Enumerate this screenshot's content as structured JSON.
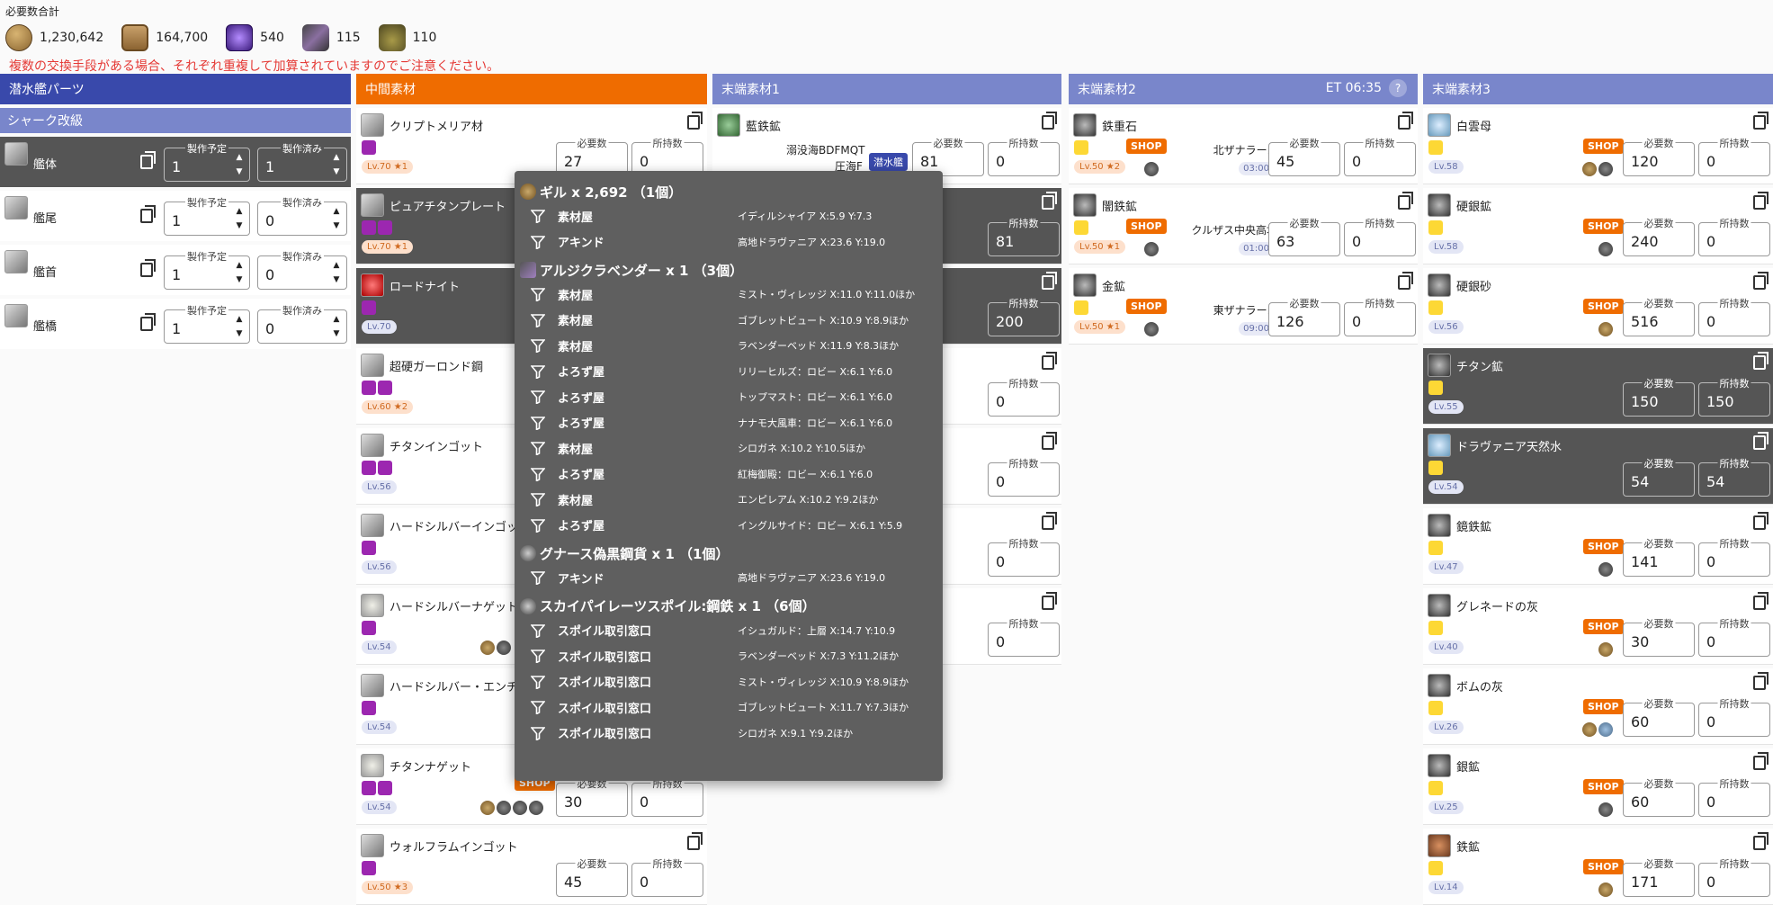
{
  "totals": {
    "label": "必要数合計",
    "items": [
      {
        "icon": "gil-icon",
        "value": "1,230,642"
      },
      {
        "icon": "note-icon",
        "value": "164,700"
      },
      {
        "icon": "purple-token-icon",
        "value": "540"
      },
      {
        "icon": "lavender-icon",
        "value": "115"
      },
      {
        "icon": "acorn-icon",
        "value": "110"
      }
    ],
    "warning": "複数の交換手段がある場合、それぞれ重複して加算されていますのでご注意ください。"
  },
  "headers": {
    "c1": "潜水艦パーツ",
    "c1sub": "シャーク改級",
    "c2": "中間素材",
    "c3": "末端素材1",
    "c4": "末端素材2",
    "c5": "末端素材3",
    "et": "ET 06:35",
    "help": "?"
  },
  "labels": {
    "planned": "製作予定",
    "done": "製作済み",
    "need": "必要数",
    "have": "所持数",
    "shop": "SHOP",
    "sub": "潜水艦"
  },
  "parts": [
    {
      "name": "艦体",
      "planned": "1",
      "done": "1"
    },
    {
      "name": "艦尾",
      "planned": "1",
      "done": "0"
    },
    {
      "name": "艦首",
      "planned": "1",
      "done": "0"
    },
    {
      "name": "艦橋",
      "planned": "1",
      "done": "0"
    }
  ],
  "mid": [
    {
      "name": "クリプトメリア材",
      "lv": "Lv.70 ★1",
      "need": "27",
      "have": "0"
    },
    {
      "name": "ピュアチタンプレート",
      "lv": "Lv.70 ★1"
    },
    {
      "name": "ロードナイト",
      "lv": "Lv.70"
    },
    {
      "name": "超硬ガーロンド鋼",
      "lv": "Lv.60 ★2"
    },
    {
      "name": "チタンインゴット",
      "lv": "Lv.56"
    },
    {
      "name": "ハードシルバーインゴット",
      "lv": "Lv.56"
    },
    {
      "name": "ハードシルバーナゲット",
      "lv": "Lv.54"
    },
    {
      "name": "ハードシルバー・エンチ",
      "lv": "Lv.54"
    },
    {
      "name": "チタンナゲット",
      "lv": "Lv.54",
      "need": "30",
      "have": "0"
    },
    {
      "name": "ウォルフラムインゴット",
      "lv": "Lv.50 ★3",
      "need": "45",
      "have": "0"
    }
  ],
  "t1": [
    {
      "name": "藍鉄鉱",
      "loc": "溺没海BDFMQT",
      "loc2": "圧海F",
      "need": "81",
      "have": "0"
    },
    {
      "have": "81"
    },
    {
      "have": "200"
    },
    {
      "have": "0"
    },
    {
      "have": "0"
    },
    {
      "have": "0"
    },
    {
      "have": "0"
    }
  ],
  "t2": [
    {
      "name": "鉄重石",
      "lv": "Lv.50 ★2",
      "zone": "北ザナラーン",
      "time": "03:00",
      "need": "45",
      "have": "0"
    },
    {
      "name": "闇鉄鉱",
      "lv": "Lv.50 ★1",
      "zone": "クルザス中央高地",
      "time": "01:00",
      "need": "63",
      "have": "0"
    },
    {
      "name": "金鉱",
      "lv": "Lv.50 ★1",
      "zone": "東ザナラーン",
      "time": "09:00",
      "need": "126",
      "have": "0"
    }
  ],
  "t3": [
    {
      "name": "白雲母",
      "lv": "Lv.58",
      "need": "120",
      "have": "0",
      "shop": true
    },
    {
      "name": "硬銀鉱",
      "lv": "Lv.58",
      "need": "240",
      "have": "0",
      "shop": true
    },
    {
      "name": "硬銀砂",
      "lv": "Lv.56",
      "need": "516",
      "have": "0",
      "shop": true
    },
    {
      "name": "チタン鉱",
      "lv": "Lv.55",
      "need": "150",
      "have": "150",
      "dk": true
    },
    {
      "name": "ドラヴァニア天然水",
      "lv": "Lv.54",
      "need": "54",
      "have": "54",
      "dk": true
    },
    {
      "name": "鏡鉄鉱",
      "lv": "Lv.47",
      "need": "141",
      "have": "0",
      "shop": true
    },
    {
      "name": "グレネードの灰",
      "lv": "Lv.40",
      "need": "30",
      "have": "0",
      "shop": true
    },
    {
      "name": "ボムの灰",
      "lv": "Lv.26",
      "need": "60",
      "have": "0",
      "shop": true
    },
    {
      "name": "銀鉱",
      "lv": "Lv.25",
      "need": "60",
      "have": "0",
      "shop": true
    },
    {
      "name": "鉄鉱",
      "lv": "Lv.14",
      "need": "171",
      "have": "0",
      "shop": true
    }
  ],
  "tooltip": [
    {
      "title": "ギル x 2,692 （1個）",
      "rows": [
        [
          "素材屋",
          "イディルシャイア X:5.9 Y:7.3"
        ],
        [
          "アキンド",
          "高地ドラヴァニア X:23.6 Y:19.0"
        ]
      ]
    },
    {
      "title": "アルジクラベンダー x 1 （3個）",
      "rows": [
        [
          "素材屋",
          "ミスト・ヴィレッジ X:11.0 Y:11.0ほか"
        ],
        [
          "素材屋",
          "ゴブレットビュート X:10.9 Y:8.9ほか"
        ],
        [
          "素材屋",
          "ラベンダーベッド X:11.9 Y:8.3ほか"
        ],
        [
          "よろず屋",
          "リリーヒルズ：ロビー X:6.1 Y:6.0"
        ],
        [
          "よろず屋",
          "トップマスト：ロビー X:6.1 Y:6.0"
        ],
        [
          "よろず屋",
          "ナナモ大風車：ロビー X:6.1 Y:6.0"
        ],
        [
          "素材屋",
          "シロガネ X:10.2 Y:10.5ほか"
        ],
        [
          "よろず屋",
          "紅梅御殿：ロビー X:6.1 Y:6.0"
        ],
        [
          "素材屋",
          "エンピレアム X:10.2 Y:9.2ほか"
        ],
        [
          "よろず屋",
          "イングルサイド：ロビー X:6.1 Y:5.9"
        ]
      ]
    },
    {
      "title": "グナース偽黒鋼貨 x 1 （1個）",
      "rows": [
        [
          "アキンド",
          "高地ドラヴァニア X:23.6 Y:19.0"
        ]
      ]
    },
    {
      "title": "スカイパイレーツスポイル:鋼鉄 x 1 （6個）",
      "rows": [
        [
          "スポイル取引窓口",
          "イシュガルド：上層 X:14.7 Y:10.9"
        ],
        [
          "スポイル取引窓口",
          "ラベンダーベッド X:7.3 Y:11.2ほか"
        ],
        [
          "スポイル取引窓口",
          "ミスト・ヴィレッジ X:10.9 Y:8.9ほか"
        ],
        [
          "スポイル取引窓口",
          "ゴブレットビュート X:11.7 Y:7.3ほか"
        ],
        [
          "スポイル取引窓口",
          "シロガネ X:9.1 Y:9.2ほか"
        ]
      ]
    }
  ]
}
